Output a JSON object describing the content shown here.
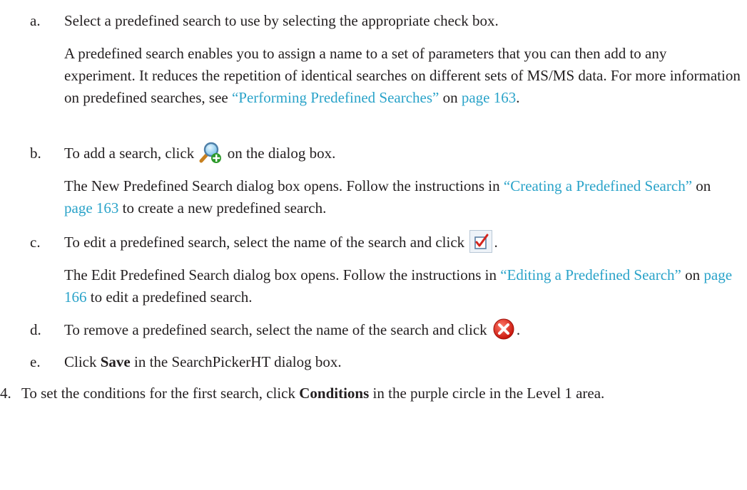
{
  "steps": [
    {
      "marker": "a.",
      "text": "Select a predefined search to use by selecting the appropriate check box.",
      "para": {
        "prefix": "A predefined search enables you to assign a name to a set of parameters that you can then add to any experiment. It reduces the repetition of identical searches on different sets of MS/MS data. For more information on predefined searches, see ",
        "link": "“Performing Predefined Searches”",
        "mid": " on ",
        "page": "page 163",
        "suffix": "."
      }
    },
    {
      "marker": "b.",
      "before": "To add a search, click ",
      "icon": "magnifier-add-icon",
      "after": " on the dialog box.",
      "para": {
        "prefix": "The New Predefined Search dialog box opens. Follow the instructions in ",
        "link": "“Creating a Predefined Search”",
        "mid": " on ",
        "page": "page 163",
        "suffix": " to create a new predefined search."
      }
    },
    {
      "marker": "c.",
      "before": "To edit a predefined search, select the name of the search and click ",
      "icon": "edit-checkbox-icon",
      "after": ".",
      "para": {
        "prefix": "The Edit Predefined Search dialog box opens. Follow the instructions in ",
        "link": "“Editing a Predefined Search”",
        "mid": " on ",
        "page": "page 166",
        "suffix": " to edit a predefined search."
      }
    },
    {
      "marker": "d.",
      "before": "To remove a predefined search, select the name of the search and click ",
      "icon": "delete-red-x-icon",
      "after": "."
    },
    {
      "marker": "e.",
      "before": "Click ",
      "bold": "Save",
      "after": " in the SearchPickerHT dialog box."
    }
  ],
  "step4": {
    "marker": "4.",
    "before": "To set the conditions for the first search, click ",
    "bold": "Conditions",
    "after": " in the purple circle in the Level 1 area."
  },
  "colors": {
    "link": "#2aa3c9",
    "text": "#231f20"
  }
}
